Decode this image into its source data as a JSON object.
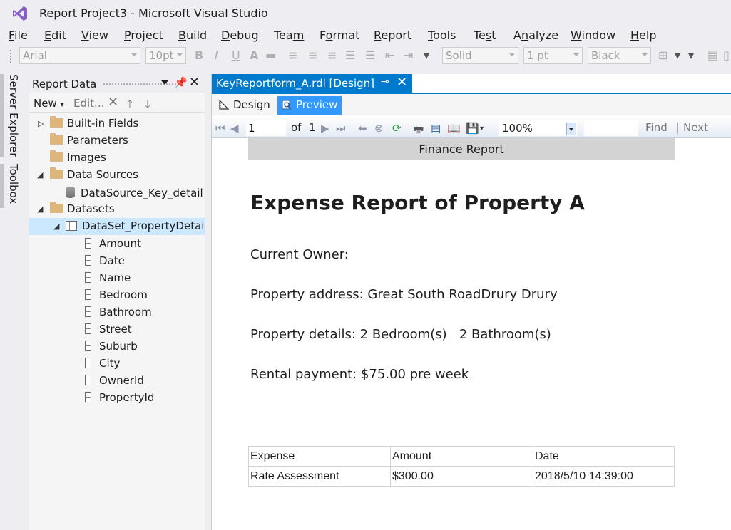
{
  "window": {
    "title": "Report Project3 - Microsoft Visual Studio"
  },
  "menu": [
    {
      "label": "File",
      "key": "F",
      "rest": "ile"
    },
    {
      "label": "Edit",
      "key": "E",
      "rest": "dit"
    },
    {
      "label": "View",
      "key": "V",
      "rest": "iew"
    },
    {
      "label": "Project",
      "key": "P",
      "rest": "roject"
    },
    {
      "label": "Build",
      "key": "B",
      "rest": "uild"
    },
    {
      "label": "Debug",
      "key": "D",
      "rest": "ebug"
    },
    {
      "label": "Team",
      "key": "",
      "pre": "Tea",
      "key2": "m"
    },
    {
      "label": "Format",
      "key": "",
      "pre": "F",
      "key2": "o",
      "post": "rmat"
    },
    {
      "label": "Report",
      "key": "R",
      "rest": "eport"
    },
    {
      "label": "Tools",
      "key": "T",
      "rest": "ools"
    },
    {
      "label": "Test",
      "key": "",
      "pre": "Te",
      "key2": "s",
      "post": "t"
    },
    {
      "label": "Analyze",
      "key": "",
      "pre": "A",
      "key2": "n",
      "post": "alyze"
    },
    {
      "label": "Window",
      "key": "W",
      "rest": "indow"
    },
    {
      "label": "Help",
      "key": "H",
      "rest": "elp"
    }
  ],
  "toolbar": {
    "font_family": "Arial",
    "font_size": "10pt",
    "line_style": "Solid",
    "line_width": "1 pt",
    "line_color": "Black"
  },
  "side_tabs": {
    "server_explorer": "Server Explorer",
    "toolbox": "Toolbox"
  },
  "report_data": {
    "title": "Report Data",
    "new_label": "New",
    "edit_label": "Edit...",
    "tree": {
      "builtin_fields": "Built-in Fields",
      "parameters": "Parameters",
      "images": "Images",
      "data_sources": "Data Sources",
      "datasource_item": "DataSource_Key_detail",
      "datasets": "Datasets",
      "dataset_item": "DataSet_PropertyDetails",
      "fields": [
        "Amount",
        "Date",
        "Name",
        "Bedroom",
        "Bathroom",
        "Street",
        "Suburb",
        "City",
        "OwnerId",
        "PropertyId"
      ]
    }
  },
  "document": {
    "tab_label": "KeyReportform_A.rdl [Design]",
    "design_label": "Design",
    "preview_label": "Preview"
  },
  "viewer": {
    "page_current": "1",
    "page_of": "of",
    "page_total": "1",
    "zoom": "100%",
    "find_label": "Find",
    "next_label": "Next"
  },
  "report": {
    "header": "Finance Report",
    "title": "Expense Report of Property A",
    "owner_line": "Current Owner:",
    "address_line": "Property address: Great South RoadDrury Drury",
    "details_line": "Property details: 2 Bedroom(s)   2 Bathroom(s)",
    "rental_line": "Rental payment: $75.00 pre week",
    "table": {
      "headers": [
        "Expense",
        "Amount",
        "Date"
      ],
      "rows": [
        [
          "Rate Assessment",
          "$300.00",
          "2018/5/10 14:39:00"
        ]
      ]
    }
  },
  "colors": {
    "accent": "#007acc",
    "preview_active": "#3399ff",
    "vs_purple": "#865fc5"
  }
}
